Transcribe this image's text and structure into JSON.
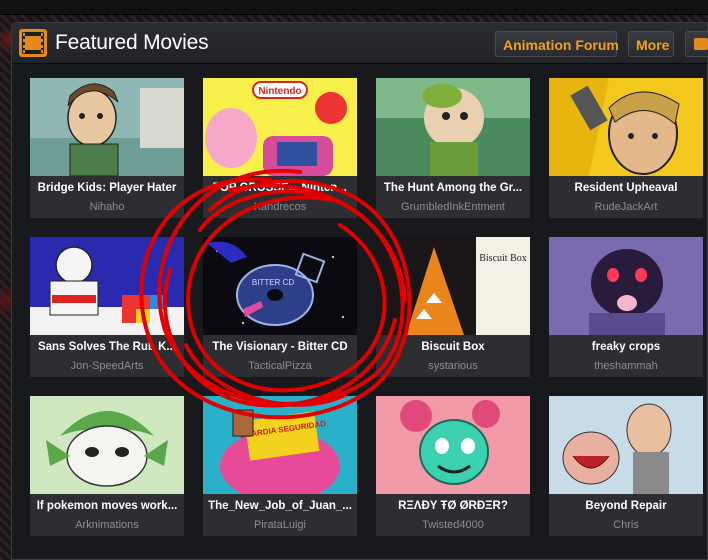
{
  "header": {
    "title": "Featured Movies",
    "icon": "film-reel-icon",
    "buttons": {
      "forum_label": "Animation Forum",
      "more_label": "More"
    },
    "accent": "#f2a01f",
    "icon_color": "#e48a1c"
  },
  "movies": [
    {
      "title": "Bridge Kids: Player Hater",
      "author": "Nihaho"
    },
    {
      "title": "TOP GROSSE... Ninten...",
      "author": "Xandrecos"
    },
    {
      "title": "The Hunt Among the Gr...",
      "author": "GrumbledInkEntment"
    },
    {
      "title": "Resident Upheaval",
      "author": "RudeJackArt"
    },
    {
      "title": "Sans Solves The Rub K...",
      "author": "Jon-SpeedArts"
    },
    {
      "title": "The Visionary - Bitter CD",
      "author": "TacticalPizza"
    },
    {
      "title": "Biscuit Box",
      "author": "systarious"
    },
    {
      "title": "freaky crops",
      "author": "theshammah"
    },
    {
      "title": "If pokemon moves work...",
      "author": "Arknimations"
    },
    {
      "title": "The_New_Job_of_Juan_...",
      "author": "PirataLuigi"
    },
    {
      "title": "RΞΛÐY ŦØ ØRÐΞR?",
      "author": "Twisted4000"
    },
    {
      "title": "Beyond Repair",
      "author": "Chris"
    }
  ],
  "thumb_texts": {
    "nintendo_logo": "Nintendo",
    "bitter_cd_label": "BITTER CD",
    "biscuit_box_label": "Biscuit Box",
    "juan_poster_text": "GUARDIA SEGURIDAD"
  },
  "annotation_color": "#e00000"
}
